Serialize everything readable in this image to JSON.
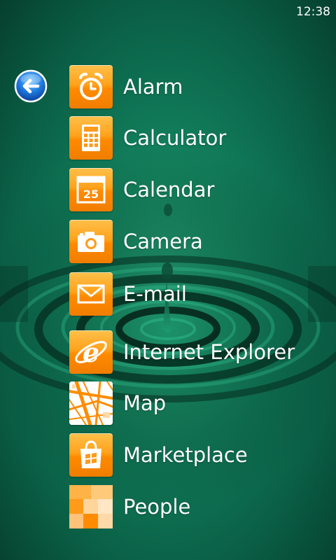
{
  "status_bar": {
    "time": "12:38"
  },
  "navigation": {
    "back_icon": "back-arrow-icon"
  },
  "apps": [
    {
      "label": "Alarm",
      "icon": "alarm-clock-icon"
    },
    {
      "label": "Calculator",
      "icon": "calculator-icon"
    },
    {
      "label": "Calendar",
      "icon": "calendar-icon",
      "calendar_day": "25"
    },
    {
      "label": "Camera",
      "icon": "camera-icon"
    },
    {
      "label": "E-mail",
      "icon": "envelope-icon"
    },
    {
      "label": "Internet Explorer",
      "icon": "internet-explorer-icon",
      "icon_letter": "e"
    },
    {
      "label": "Map",
      "icon": "map-icon"
    },
    {
      "label": "Marketplace",
      "icon": "shopping-bag-icon"
    },
    {
      "label": "People",
      "icon": "people-tiles-icon"
    }
  ],
  "colors": {
    "tile_orange": "#ff9500",
    "background_green": "#0f7555",
    "text": "#ffffff"
  }
}
